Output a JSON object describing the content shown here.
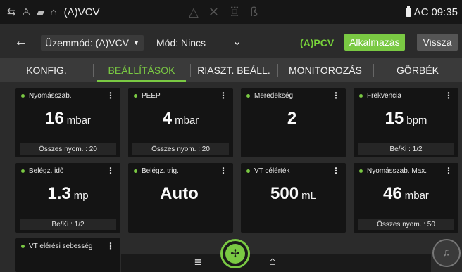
{
  "status": {
    "mode": "(A)VCV",
    "power": "AC",
    "time": "09:35",
    "left_icons": [
      "circuit-icon",
      "patient-icon",
      "adult-icon",
      "building-icon"
    ],
    "center_icons": [
      "warning-triangle-icon",
      "tools-icon",
      "patient-monitor-icon",
      "lung-icon"
    ]
  },
  "modebar": {
    "back_glyph": "←",
    "uzemmod_label": "Üzemmód: (A)VCV",
    "mod_label": "Mód: Nincs",
    "apcv": "(A)PCV",
    "apply": "Alkalmazás",
    "back": "Vissza"
  },
  "tabs": [
    {
      "label": "KONFIG."
    },
    {
      "label": "BEÁLLÍTÁSOK"
    },
    {
      "label": "RIASZT. BEÁLL."
    },
    {
      "label": "MONITOROZÁS"
    },
    {
      "label": "GÖRBÉK"
    }
  ],
  "active_tab": "BEÁLLÍTÁSOK",
  "tiles": [
    {
      "title": "Nyomásszab.",
      "value": "16",
      "unit": "mbar",
      "footer": "Összes nyom. : 20"
    },
    {
      "title": "PEEP",
      "value": "4",
      "unit": "mbar",
      "footer": "Összes nyom. : 20"
    },
    {
      "title": "Meredekség",
      "value": "2",
      "unit": "",
      "footer": ""
    },
    {
      "title": "Frekvencia",
      "value": "15",
      "unit": "bpm",
      "footer": "Be/Ki : 1/2"
    },
    {
      "title": "Belégz. idő",
      "value": "1.3",
      "unit": "mp",
      "footer": "Be/Ki : 1/2"
    },
    {
      "title": "Belégz. trig.",
      "value": "Auto",
      "unit": "",
      "footer": ""
    },
    {
      "title": "VT célérték",
      "value": "500",
      "unit": "mL",
      "footer": ""
    },
    {
      "title": "Nyomásszab. Max.",
      "value": "46",
      "unit": "mbar",
      "footer": "Összes nyom. : 50"
    },
    {
      "title": "VT elérési sebesség",
      "value": "",
      "unit": "",
      "footer": ""
    }
  ],
  "colors": {
    "accent": "#7ac943",
    "background": "#2b2b2b",
    "tile": "#141414"
  }
}
